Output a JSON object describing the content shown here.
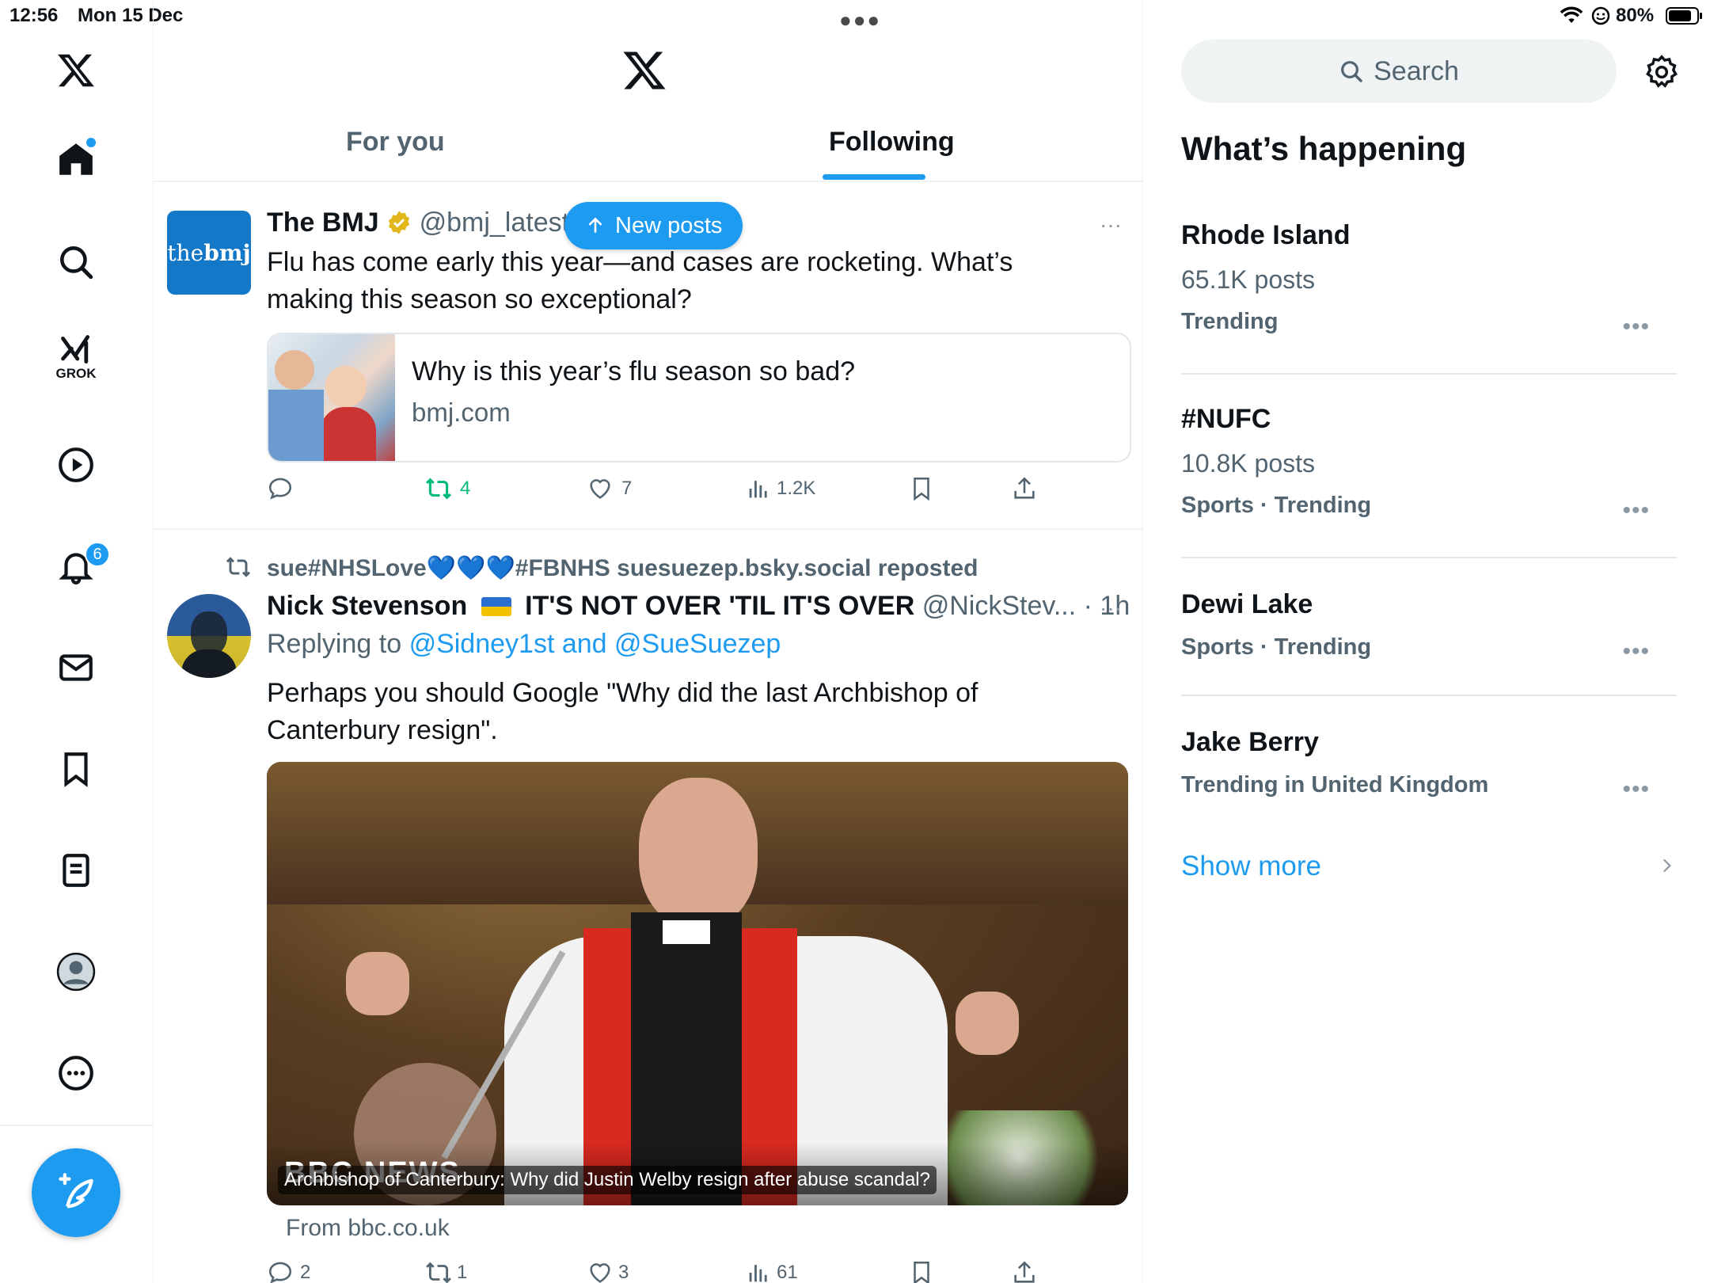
{
  "status_bar": {
    "time": "12:56",
    "date": "Mon 15 Dec",
    "battery": "80%"
  },
  "nav": {
    "grok_label": "GROK",
    "notifications_badge": "6",
    "icons": [
      "x-logo-icon",
      "home-icon",
      "search-icon",
      "grok-icon",
      "video-icon",
      "bell-icon",
      "mail-icon",
      "bookmark-icon",
      "list-icon",
      "profile-icon",
      "more-icon",
      "compose-icon"
    ]
  },
  "tabs": {
    "for_you": "For you",
    "following": "Following"
  },
  "new_posts_pill": "New posts",
  "posts": [
    {
      "avatar_text_a": "the",
      "avatar_text_b": "bmj",
      "name": "The BMJ",
      "handle": "@bmj_latest",
      "text": "Flu has come early this year—and cases are rocketing. What’s making this season so exceptional?",
      "card_title": "Why is this year’s flu season so bad?",
      "card_domain": "bmj.com",
      "replies": "",
      "reposts": "4",
      "likes": "7",
      "views": "1.2K"
    },
    {
      "repost_by": "sue#NHSLove💙💙💙#FBNHS suesuezep.bsky.social reposted",
      "name_a": "Nick Stevenson",
      "name_flag": "🇺🇦",
      "name_b": "IT'S NOT OVER 'TIL IT'S OVER",
      "handle": "@NickStev...",
      "time": "· 1h",
      "replying_prefix": "Replying to",
      "replying_to": "@Sidney1st and @SueSuezep",
      "text": "Perhaps you should Google \"Why did the last Archbishop of Canterbury resign\".",
      "media_watermark": "BBC NEWS",
      "media_caption": "Archbishop of Canterbury: Why did Justin Welby resign after abuse scandal?",
      "media_source": "From bbc.co.uk",
      "replies": "2",
      "reposts": "1",
      "likes": "3",
      "views": "61"
    }
  ],
  "right": {
    "search_placeholder": "Search",
    "heading": "What’s happening",
    "trends": [
      {
        "title": "Rhode Island",
        "posts": "65.1K posts",
        "context": "Trending"
      },
      {
        "title": "#NUFC",
        "posts": "10.8K posts",
        "context": "Sports · Trending"
      },
      {
        "title": "Dewi Lake",
        "posts": "",
        "context": "Sports · Trending"
      },
      {
        "title": "Jake Berry",
        "posts": "",
        "context": "Trending in United Kingdom"
      }
    ],
    "show_more": "Show more"
  },
  "colors": {
    "accent": "#1d9bf0",
    "repost_green": "#00ba7c",
    "text": "#0f1419",
    "muted": "#536471"
  }
}
